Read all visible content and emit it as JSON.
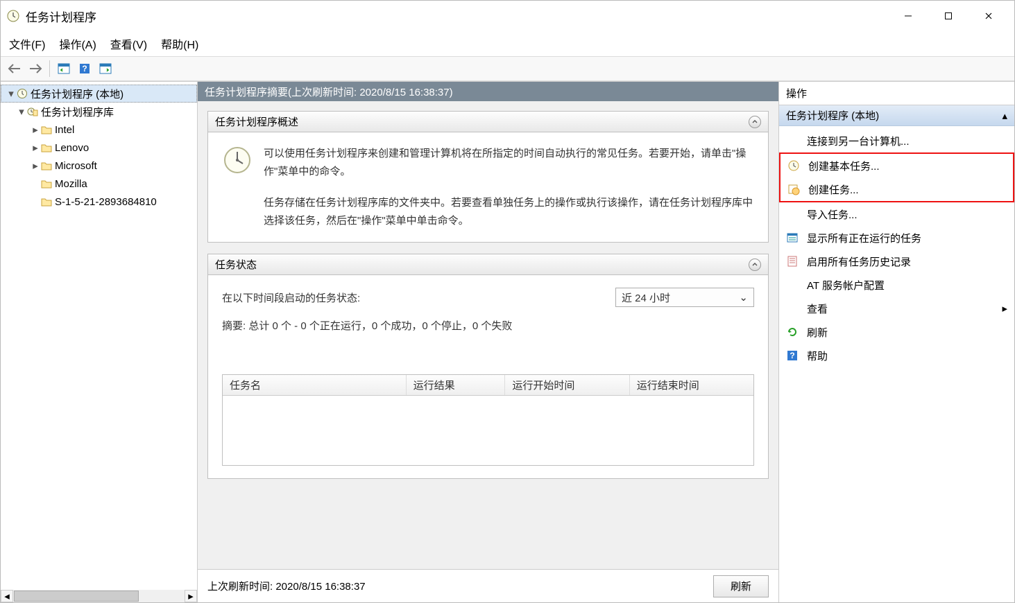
{
  "window": {
    "title": "任务计划程序"
  },
  "menu": {
    "file": "文件(F)",
    "operate": "操作(A)",
    "view": "查看(V)",
    "help": "帮助(H)"
  },
  "tree": {
    "root": "任务计划程序 (本地)",
    "library": "任务计划程序库",
    "items": [
      "Intel",
      "Lenovo",
      "Microsoft",
      "Mozilla",
      "S-1-5-21-2893684810"
    ]
  },
  "center": {
    "header": "任务计划程序摘要(上次刷新时间: 2020/8/15 16:38:37)",
    "overview_title": "任务计划程序概述",
    "overview_p1": "可以使用任务计划程序来创建和管理计算机将在所指定的时间自动执行的常见任务。若要开始，请单击\"操作\"菜单中的命令。",
    "overview_p2": "任务存储在任务计划程序库的文件夹中。若要查看单独任务上的操作或执行该操作，请在任务计划程序库中选择该任务，然后在\"操作\"菜单中单击命令。",
    "status_title": "任务状态",
    "status_label": "在以下时间段启动的任务状态:",
    "period_value": "近 24 小时",
    "summary": "摘要: 总计 0 个 - 0 个正在运行，0 个成功，0 个停止，0 个失败",
    "cols": {
      "name": "任务名",
      "result": "运行结果",
      "start": "运行开始时间",
      "end": "运行结束时间"
    },
    "footer_label": "上次刷新时间: 2020/8/15 16:38:37",
    "refresh_btn": "刷新"
  },
  "actions": {
    "header": "操作",
    "sub": "任务计划程序 (本地)",
    "items": {
      "connect": "连接到另一台计算机...",
      "create_basic": "创建基本任务...",
      "create": "创建任务...",
      "import": "导入任务...",
      "show_running": "显示所有正在运行的任务",
      "enable_history": "启用所有任务历史记录",
      "at_config": "AT 服务帐户配置",
      "view": "查看",
      "refresh": "刷新",
      "help": "帮助"
    }
  }
}
